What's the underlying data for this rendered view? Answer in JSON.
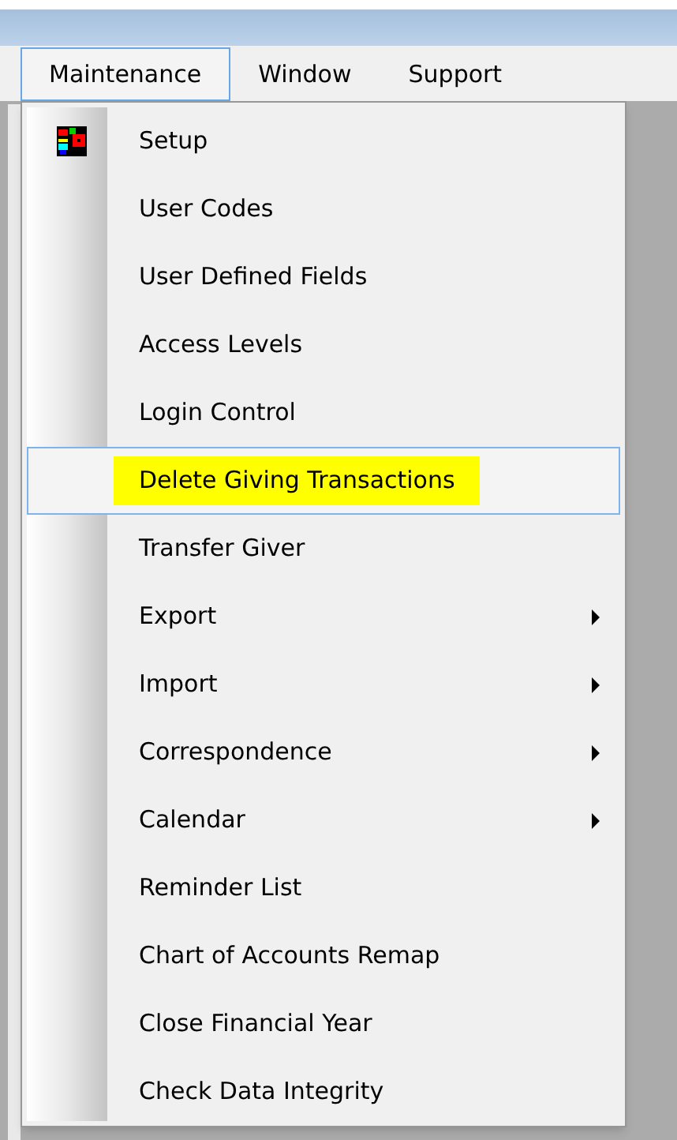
{
  "menu_bar": [
    {
      "label": "Maintenance",
      "selected": true
    },
    {
      "label": "Window",
      "selected": false
    },
    {
      "label": "Support",
      "selected": false
    }
  ],
  "menu": {
    "items": [
      {
        "label": "Setup",
        "kind": "icon",
        "selected": false
      },
      {
        "label": "User Codes",
        "kind": "plain",
        "selected": false
      },
      {
        "label": "User Defined Fields",
        "kind": "plain",
        "selected": false
      },
      {
        "label": "Access Levels",
        "kind": "plain",
        "selected": false
      },
      {
        "label": "Login Control",
        "kind": "plain",
        "selected": false
      },
      {
        "label": "Delete Giving Transactions",
        "kind": "plain",
        "selected": true
      },
      {
        "label": "Transfer Giver",
        "kind": "plain",
        "selected": false
      },
      {
        "label": "Export",
        "kind": "submenu",
        "selected": false
      },
      {
        "label": "Import",
        "kind": "submenu",
        "selected": false
      },
      {
        "label": "Correspondence",
        "kind": "submenu",
        "selected": false
      },
      {
        "label": "Calendar",
        "kind": "submenu",
        "selected": false
      },
      {
        "label": "Reminder List",
        "kind": "plain",
        "selected": false
      },
      {
        "label": "Chart of Accounts Remap",
        "kind": "plain",
        "selected": false
      },
      {
        "label": "Close Financial Year",
        "kind": "plain",
        "selected": false
      },
      {
        "label": "Check Data Integrity",
        "kind": "plain",
        "selected": false
      }
    ]
  }
}
